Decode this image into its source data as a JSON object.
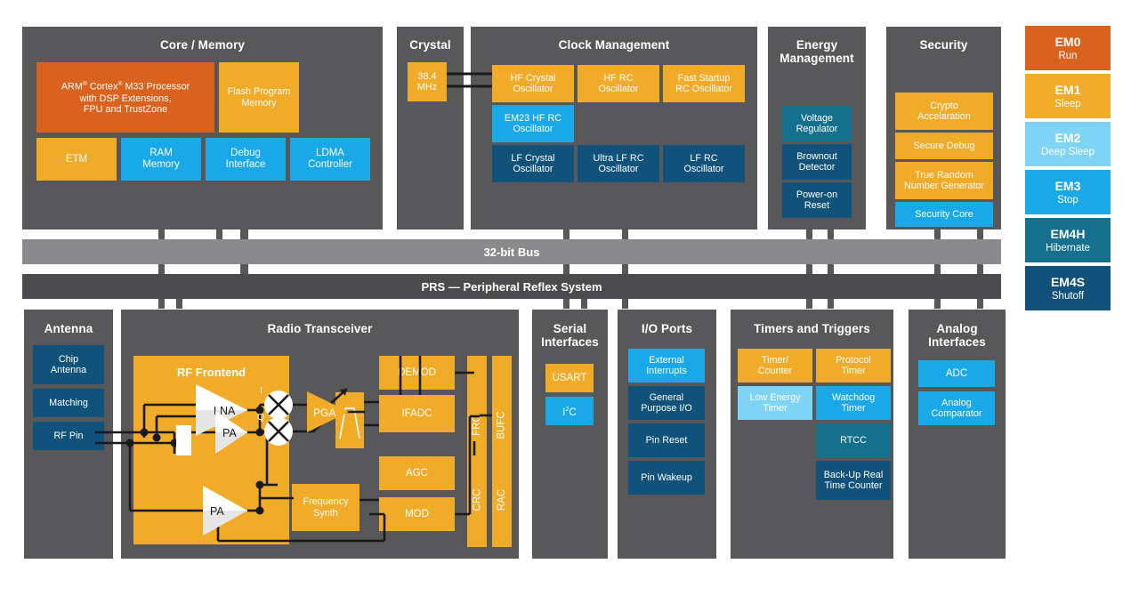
{
  "colors": {
    "panel_bg": "#58585a",
    "orange": "#d9621e",
    "amber": "#f0ab28",
    "cyan": "#19a8e8",
    "light_cyan": "#7fd4f5",
    "navy": "#10527a",
    "teal": "#14708c",
    "bus_gray": "#8a8a8c",
    "prs_gray": "#4b4b4d",
    "page_bg": "#ffffff",
    "wire": "#1a1a1a"
  },
  "core_memory": {
    "title": "Core / Memory",
    "blocks": [
      {
        "label": "ARM® Cortex® M33 Processor with DSP Extensions, FPU and TrustZone",
        "color": "orange"
      },
      {
        "label": "Flash Program Memory",
        "color": "amber"
      },
      {
        "label": "ETM",
        "color": "amber"
      },
      {
        "label": "RAM Memory",
        "color": "cyan"
      },
      {
        "label": "Debug Interface",
        "color": "cyan"
      },
      {
        "label": "LDMA Controller",
        "color": "cyan"
      }
    ]
  },
  "crystal": {
    "title": "Crystal",
    "blocks": [
      {
        "label": "38.4 MHz",
        "color": "amber"
      }
    ]
  },
  "clock_management": {
    "title": "Clock Management",
    "blocks": [
      {
        "label": "HF Crystal Oscillator",
        "color": "amber"
      },
      {
        "label": "HF RC Oscillator",
        "color": "amber"
      },
      {
        "label": "Fast Startup RC Oscillator",
        "color": "amber"
      },
      {
        "label": "EM23 HF RC Oscillator",
        "color": "cyan"
      },
      {
        "label": "LF Crystal Oscillator",
        "color": "navy"
      },
      {
        "label": "Ultra LF RC Oscillator",
        "color": "navy"
      },
      {
        "label": "LF RC Oscillator",
        "color": "navy"
      }
    ]
  },
  "energy_management": {
    "title": "Energy Management",
    "blocks": [
      {
        "label": "Voltage Regulator",
        "color": "teal"
      },
      {
        "label": "Brownout Detector",
        "color": "navy"
      },
      {
        "label": "Power-on Reset",
        "color": "navy"
      }
    ]
  },
  "security": {
    "title": "Security",
    "blocks": [
      {
        "label": "Crypto Accelaration",
        "color": "amber"
      },
      {
        "label": "Secure Debug",
        "color": "amber"
      },
      {
        "label": "True Random Number Generator",
        "color": "amber"
      },
      {
        "label": "Security Core",
        "color": "cyan"
      }
    ]
  },
  "buses": [
    {
      "label": "32-bit Bus",
      "color": "bus_gray"
    },
    {
      "label": "PRS — Peripheral Reflex System",
      "color": "prs_gray"
    }
  ],
  "antenna": {
    "title": "Antenna",
    "blocks": [
      {
        "label": "Chip Antenna",
        "color": "navy"
      },
      {
        "label": "Matching",
        "color": "navy"
      },
      {
        "label": "RF Pin",
        "color": "navy"
      }
    ]
  },
  "radio_transceiver": {
    "title": "Radio Transceiver",
    "frontend_title": "RF Frontend",
    "frontend_parts": [
      {
        "label": "LNA",
        "shape": "amplifier"
      },
      {
        "label": "PA",
        "shape": "amplifier"
      },
      {
        "label": "PA",
        "shape": "amplifier"
      },
      {
        "label": "I",
        "shape": "mixer-label"
      },
      {
        "label": "Q",
        "shape": "mixer-label"
      },
      {
        "label": "",
        "shape": "mixer"
      },
      {
        "label": "",
        "shape": "mixer"
      },
      {
        "label": "",
        "shape": "switch"
      }
    ],
    "blocks": [
      {
        "label": "PGA",
        "color": "amber",
        "shape": "amplifier"
      },
      {
        "label": "",
        "color": "amber",
        "shape": "filter"
      },
      {
        "label": "DEMOD",
        "color": "amber"
      },
      {
        "label": "IFADC",
        "color": "amber"
      },
      {
        "label": "AGC",
        "color": "amber"
      },
      {
        "label": "MOD",
        "color": "amber"
      },
      {
        "label": "Frequency Synth",
        "color": "amber"
      },
      {
        "label": "FRC",
        "color": "amber",
        "vertical": true
      },
      {
        "label": "BUFC",
        "color": "amber",
        "vertical": true
      },
      {
        "label": "CRC",
        "color": "amber",
        "vertical": true
      },
      {
        "label": "RAC",
        "color": "amber",
        "vertical": true
      }
    ]
  },
  "serial_interfaces": {
    "title": "Serial Interfaces",
    "blocks": [
      {
        "label": "USART",
        "color": "amber"
      },
      {
        "label": "I²C",
        "color": "cyan"
      }
    ]
  },
  "io_ports": {
    "title": "I/O Ports",
    "blocks": [
      {
        "label": "External Interrupts",
        "color": "cyan"
      },
      {
        "label": "General Purpose I/O",
        "color": "navy"
      },
      {
        "label": "Pin Reset",
        "color": "navy"
      },
      {
        "label": "Pin Wakeup",
        "color": "navy"
      }
    ]
  },
  "timers_and_triggers": {
    "title": "Timers and Triggers",
    "blocks": [
      {
        "label": "Timer/ Counter",
        "color": "amber"
      },
      {
        "label": "Protocol Timer",
        "color": "amber"
      },
      {
        "label": "Low Energy Timer",
        "color": "light_cyan"
      },
      {
        "label": "Watchdog Timer",
        "color": "cyan"
      },
      {
        "label": "RTCC",
        "color": "teal"
      },
      {
        "label": "Back-Up Real Time Counter",
        "color": "navy"
      }
    ]
  },
  "analog_interfaces": {
    "title": "Analog Interfaces",
    "blocks": [
      {
        "label": "ADC",
        "color": "cyan"
      },
      {
        "label": "Analog Comparator",
        "color": "cyan"
      }
    ]
  },
  "energy_modes": [
    {
      "name": "EM0",
      "state": "Run",
      "color": "orange"
    },
    {
      "name": "EM1",
      "state": "Sleep",
      "color": "amber"
    },
    {
      "name": "EM2",
      "state": "Deep Sleep",
      "color": "light_cyan"
    },
    {
      "name": "EM3",
      "state": "Stop",
      "color": "cyan"
    },
    {
      "name": "EM4H",
      "state": "Hibernate",
      "color": "teal"
    },
    {
      "name": "EM4S",
      "state": "Shutoff",
      "color": "navy"
    }
  ]
}
